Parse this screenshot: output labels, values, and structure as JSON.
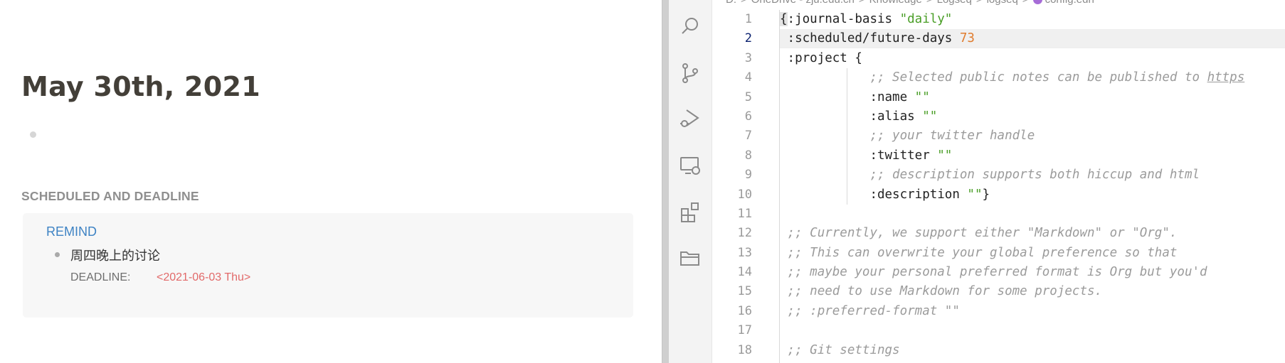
{
  "logseq": {
    "journal_title": "May 30th, 2021",
    "scheduled_section": {
      "heading": "SCHEDULED AND DEADLINE",
      "remind_label": "REMIND",
      "task_text": "周四晚上的讨论",
      "deadline_label": "DEADLINE:",
      "deadline_value": "<2021-06-03 Thu>"
    }
  },
  "vscode": {
    "breadcrumb": [
      "D:",
      "OneDrive - zju.edu.cn",
      "Knowledge",
      "Logseq",
      "logseq",
      "config.edn"
    ],
    "breadcrumb_separator": ">",
    "activity_icons": [
      "search-icon",
      "source-control-icon",
      "run-debug-icon",
      "remote-explorer-icon",
      "extensions-icon",
      "folder-icon"
    ],
    "line_numbers": [
      "1",
      "2",
      "3",
      "4",
      "5",
      "6",
      "7",
      "8",
      "9",
      "10",
      "11",
      "12",
      "13",
      "14",
      "15",
      "16",
      "17",
      "18"
    ],
    "active_line": "2",
    "code": {
      "l1_brace": "{",
      "l1_key": ":journal-basis ",
      "l1_val": "\"daily\"",
      "l2_key": ":scheduled/future-days ",
      "l2_val": "73",
      "l3": ":project {",
      "l4_comment": ";; Selected public notes can be published to ",
      "l4_link": "https",
      "l5_key": ":name ",
      "l5_val": "\"\"",
      "l6_key": ":alias ",
      "l6_val": "\"\"",
      "l7": ";; your twitter handle",
      "l8_key": ":twitter ",
      "l8_val": "\"\"",
      "l9": ";; description supports both hiccup and html",
      "l10_key": ":description ",
      "l10_val": "\"\"",
      "l10_close": "}",
      "l12": ";; Currently, we support either \"Markdown\" or \"Org\".",
      "l13": ";; This can overwrite your global preference so that",
      "l14": ";; maybe your personal preferred format is Org but you'd",
      "l15": ";; need to use Markdown for some projects.",
      "l16": ";; :preferred-format \"\"",
      "l18": ";; Git settings"
    },
    "colors": {
      "string": "#4a9e27",
      "number": "#e07c2e",
      "comment": "#9b9b9b",
      "file_icon": "#a66cd7"
    }
  }
}
